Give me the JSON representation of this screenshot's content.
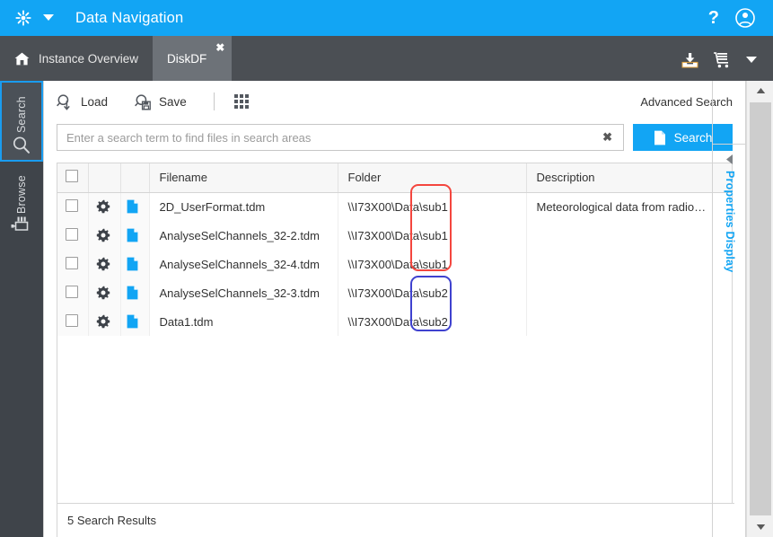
{
  "titlebar": {
    "logo_icon": "asterisk-icon",
    "caret_icon": "chevron-down-icon",
    "title": "Data Navigation",
    "help_label": "?",
    "help_icon": "help-icon",
    "user_icon": "user-account-icon",
    "bg_color": "#12a5f4"
  },
  "tabbar": {
    "home_icon": "home-icon",
    "tabs": [
      {
        "label": "Instance Overview",
        "active": false,
        "closable": false
      },
      {
        "label": "DiskDF",
        "active": true,
        "closable": true,
        "close_label": "✖"
      }
    ],
    "actions": [
      {
        "icon": "download-icon",
        "label": "Download"
      },
      {
        "icon": "cart-icon",
        "label": "Data Cart"
      },
      {
        "icon": "chevron-down-icon",
        "label": "Cart Menu"
      }
    ],
    "bg_color": "#4b4f54",
    "active_tab_color": "#6d7278"
  },
  "left_rail": {
    "items": [
      {
        "label": "Search",
        "icon": "magnifier-icon",
        "active": true
      },
      {
        "label": "Browse",
        "icon": "browse-tree-icon",
        "active": false
      }
    ],
    "bg_color": "#3f444a",
    "active_outline_color": "#1a9cf0"
  },
  "toolbar": {
    "load_label": "Load",
    "load_icon": "load-search-icon",
    "save_label": "Save",
    "save_icon": "save-search-icon",
    "grid_icon": "grid-view-icon",
    "advanced_search_label": "Advanced Search"
  },
  "search": {
    "placeholder": "Enter a search term to find files in search areas",
    "value": "",
    "clear_icon": "clear-x-icon",
    "clear_label": "✖",
    "button_label": "Search",
    "button_icon": "document-icon",
    "button_color": "#12a5f4"
  },
  "table": {
    "select_all_checked": false,
    "columns": [
      {
        "key": "check",
        "label": ""
      },
      {
        "key": "gear",
        "label": ""
      },
      {
        "key": "file",
        "label": ""
      },
      {
        "key": "name",
        "label": "Filename"
      },
      {
        "key": "folder",
        "label": "Folder"
      },
      {
        "key": "desc",
        "label": "Description"
      }
    ],
    "rows": [
      {
        "checked": false,
        "gear_icon": "gear-icon",
        "file_icon": "tdm-file-icon",
        "name": "2D_UserFormat.tdm",
        "folder": "\\\\I73X00\\Data\\sub1",
        "desc": "Meteorological data from radio…"
      },
      {
        "checked": false,
        "gear_icon": "gear-icon",
        "file_icon": "tdm-file-icon",
        "name": "AnalyseSelChannels_32-2.tdm",
        "folder": "\\\\I73X00\\Data\\sub1",
        "desc": ""
      },
      {
        "checked": false,
        "gear_icon": "gear-icon",
        "file_icon": "tdm-file-icon",
        "name": "AnalyseSelChannels_32-4.tdm",
        "folder": "\\\\I73X00\\Data\\sub1",
        "desc": ""
      },
      {
        "checked": false,
        "gear_icon": "gear-icon",
        "file_icon": "tdm-file-icon",
        "name": "AnalyseSelChannels_32-3.tdm",
        "folder": "\\\\I73X00\\Data\\sub2",
        "desc": ""
      },
      {
        "checked": false,
        "gear_icon": "gear-icon",
        "file_icon": "tdm-file-icon",
        "name": "Data1.tdm",
        "folder": "\\\\I73X00\\Data\\sub2",
        "desc": ""
      }
    ]
  },
  "statusbar": {
    "text": "5 Search Results"
  },
  "properties_panel": {
    "label": "Properties Display",
    "collapse_icon": "chevron-left-icon",
    "color": "#12a5f4"
  },
  "scrollbar": {
    "up_icon": "chevron-up-icon",
    "down_icon": "chevron-down-icon"
  },
  "annotations": [
    {
      "id": "anno-red",
      "color": "#f4463e",
      "covers": "folder values rows 1-3 (sub1)"
    },
    {
      "id": "anno-blue",
      "color": "#3f42cf",
      "covers": "folder values rows 4-5 (sub2)"
    }
  ]
}
